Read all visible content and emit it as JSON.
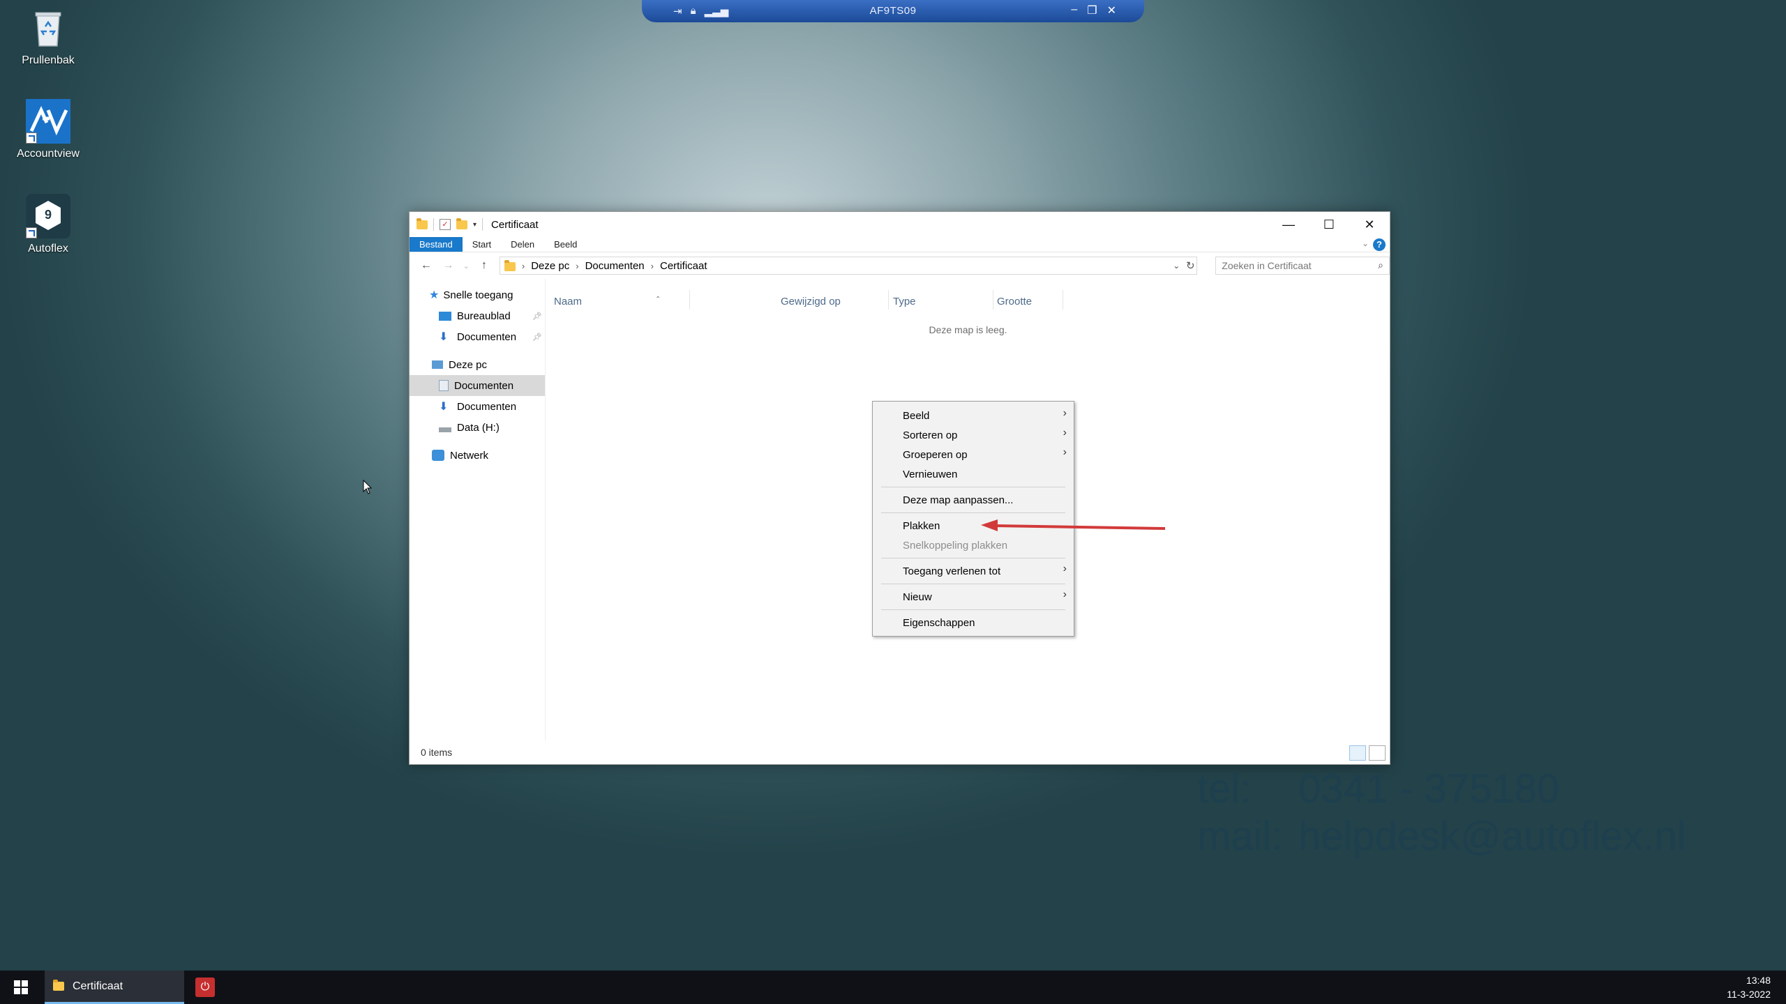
{
  "desktop": {
    "icons": [
      {
        "label": "Prullenbak",
        "icon": "recycle-bin-icon"
      },
      {
        "label": "Accountview",
        "icon": "accountview-icon"
      },
      {
        "label": "Autoflex",
        "icon": "autoflex-icon",
        "badge": "9"
      }
    ],
    "contact": {
      "tel_label": "tel:",
      "tel_value": "0341 - 375180",
      "mail_label": "mail:",
      "mail_value": "helpdesk@autoflex.nl"
    }
  },
  "rdp_bar": {
    "title": "AF9TS09"
  },
  "window": {
    "title": "Certificaat",
    "ribbon_tabs": [
      "Bestand",
      "Start",
      "Delen",
      "Beeld"
    ],
    "address": {
      "parts": [
        "Deze pc",
        "Documenten",
        "Certificaat"
      ]
    },
    "search_placeholder": "Zoeken in Certificaat",
    "nav_pane": {
      "quick_access": "Snelle toegang",
      "items": [
        {
          "label": "Bureaublad",
          "pinned": true
        },
        {
          "label": "Documenten",
          "pinned": true
        }
      ],
      "this_pc": "Deze pc",
      "pc_items": [
        {
          "label": "Documenten",
          "selected": true
        },
        {
          "label": "Documenten",
          "selected": false
        },
        {
          "label": "Data (H:)",
          "selected": false
        }
      ],
      "network": "Netwerk"
    },
    "columns": [
      "Naam",
      "Gewijzigd op",
      "Type",
      "Grootte"
    ],
    "empty_text": "Deze map is leeg.",
    "status": "0 items"
  },
  "context_menu": {
    "items": [
      {
        "label": "Beeld",
        "submenu": true
      },
      {
        "label": "Sorteren op",
        "submenu": true
      },
      {
        "label": "Groeperen op",
        "submenu": true
      },
      {
        "label": "Vernieuwen"
      },
      {
        "label": "Deze map aanpassen..."
      },
      {
        "label": "Plakken"
      },
      {
        "label": "Snelkoppeling plakken",
        "disabled": true
      },
      {
        "label": "Toegang verlenen tot",
        "submenu": true
      },
      {
        "label": "Nieuw",
        "submenu": true
      },
      {
        "label": "Eigenschappen"
      }
    ]
  },
  "taskbar": {
    "active_task": "Certificaat",
    "time": "13:48",
    "date": "11-3-2022"
  },
  "colors": {
    "accent": "#1979ca",
    "annotation_arrow": "#d23a3a"
  }
}
